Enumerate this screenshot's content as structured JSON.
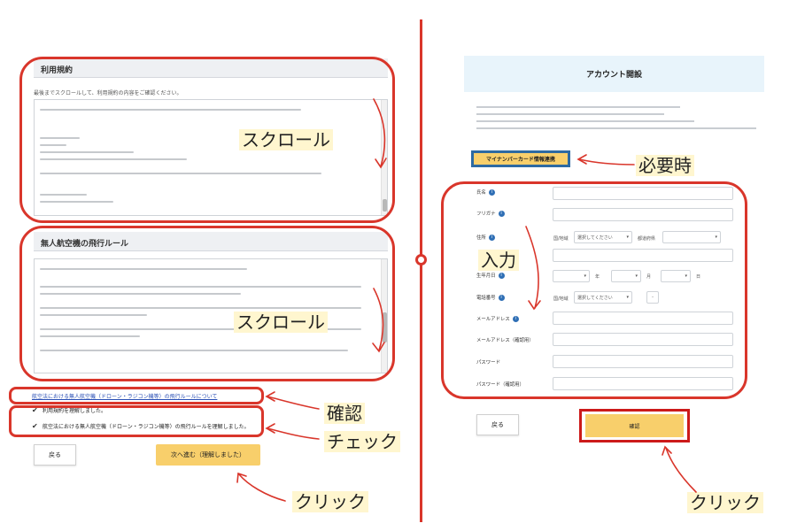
{
  "left": {
    "terms_title": "利用規約",
    "terms_intro": "最後までスクロールして、利用規約の内容をご確認ください。",
    "drone_title": "無人航空機の飛行ルール",
    "link_text": "航空法における無人航空機（ドローン・ラジコン機等）の飛行ルールについて",
    "check1": "利用規約を理解しました。",
    "check2": "航空法における無人航空機（ドローン・ラジコン機等）の飛行ルールを理解しました。",
    "back_label": "戻る",
    "next_label": "次へ進む（理解しました）"
  },
  "right": {
    "title": "アカウント開設",
    "myna_label": "マイナンバーカード情報連携",
    "fields": [
      {
        "label": "氏名"
      },
      {
        "label": "フリガナ"
      },
      {
        "label": "住所"
      },
      {
        "label": "生年月日"
      },
      {
        "label": "電話番号"
      },
      {
        "label": "メールアドレス"
      },
      {
        "label": "メールアドレス（確認用）"
      },
      {
        "label": "パスワード"
      },
      {
        "label": "パスワード（確認用）"
      }
    ],
    "address_country_label": "国/地域",
    "address_country_select": "選択してください",
    "address_pref_label": "都道府県",
    "phone_country_label": "国/地域",
    "phone_country_select": "選択してください",
    "phone_dash": "-",
    "dob_year": "年",
    "dob_month": "月",
    "dob_day": "日",
    "back_label": "戻る",
    "confirm_label": "確認"
  },
  "annotations": {
    "scroll1": "スクロール",
    "scroll2": "スクロール",
    "confirm": "確認",
    "check": "チェック",
    "click_left": "クリック",
    "required": "必要時",
    "input": "入力",
    "click_right": "クリック"
  },
  "colors": {
    "annotation_red": "#d9362b",
    "button_yellow": "#f8cf6b",
    "header_blue": "#e8f4fb",
    "myna_border": "#2d6aa2",
    "info_icon": "#2f6fb5"
  }
}
